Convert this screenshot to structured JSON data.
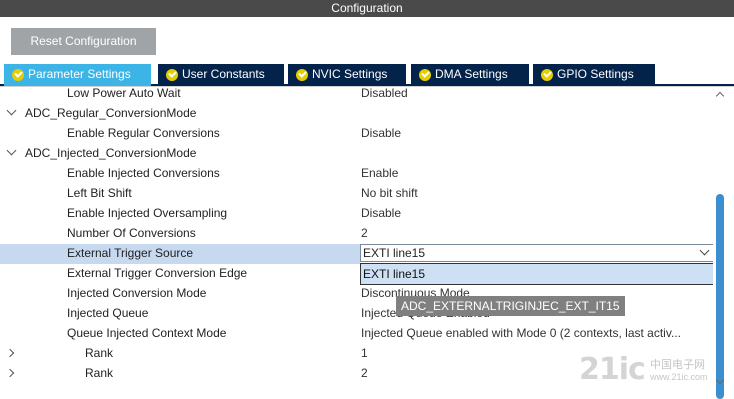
{
  "window": {
    "title": "Configuration"
  },
  "toolbar": {
    "reset_label": "Reset Configuration"
  },
  "tabs": [
    {
      "label": "Parameter Settings",
      "active": true
    },
    {
      "label": "User Constants",
      "active": false
    },
    {
      "label": "NVIC Settings",
      "active": false
    },
    {
      "label": "DMA Settings",
      "active": false
    },
    {
      "label": "GPIO Settings",
      "active": false
    }
  ],
  "params": {
    "low_power_auto_wait": {
      "name": "Low Power Auto Wait",
      "value": "Disabled"
    },
    "regular_group": {
      "name": "ADC_Regular_ConversionMode"
    },
    "enable_regular": {
      "name": "Enable Regular Conversions",
      "value": "Disable"
    },
    "injected_group": {
      "name": "ADC_Injected_ConversionMode"
    },
    "enable_injected": {
      "name": "Enable Injected Conversions",
      "value": "Enable"
    },
    "left_bit_shift": {
      "name": "Left Bit Shift",
      "value": "No bit shift"
    },
    "injected_oversampling": {
      "name": "Enable Injected Oversampling",
      "value": "Disable"
    },
    "num_conversions": {
      "name": "Number Of Conversions",
      "value": "2"
    },
    "ext_trigger_source": {
      "name": "External Trigger Source",
      "value": "EXTI line15"
    },
    "ext_trigger_edge": {
      "name": "External Trigger Conversion Edge"
    },
    "injected_conv_mode": {
      "name": "Injected Conversion Mode",
      "value": "Discontinuous Mode"
    },
    "injected_queue": {
      "name": "Injected Queue",
      "value": "Injected Queue Enabled"
    },
    "queue_context_mode": {
      "name": "Queue Injected Context Mode",
      "value": "Injected Queue enabled with Mode 0 (2 contexts, last activ..."
    },
    "rank1": {
      "name": "Rank",
      "value": "1"
    },
    "rank2": {
      "name": "Rank",
      "value": "2"
    }
  },
  "dropdown": {
    "option": "EXTI line15"
  },
  "tooltip": {
    "text": "ADC_EXTERNALTRIGINJEC_EXT_IT15"
  },
  "watermark": {
    "logo": "21ic",
    "brand": "中国电子网",
    "url": "www.21ic.com"
  },
  "colors": {
    "accent": "#3cb4e6",
    "tab_bg": "#03234b",
    "selected_row": "#c6d9ef",
    "check": "#e6cd00"
  }
}
